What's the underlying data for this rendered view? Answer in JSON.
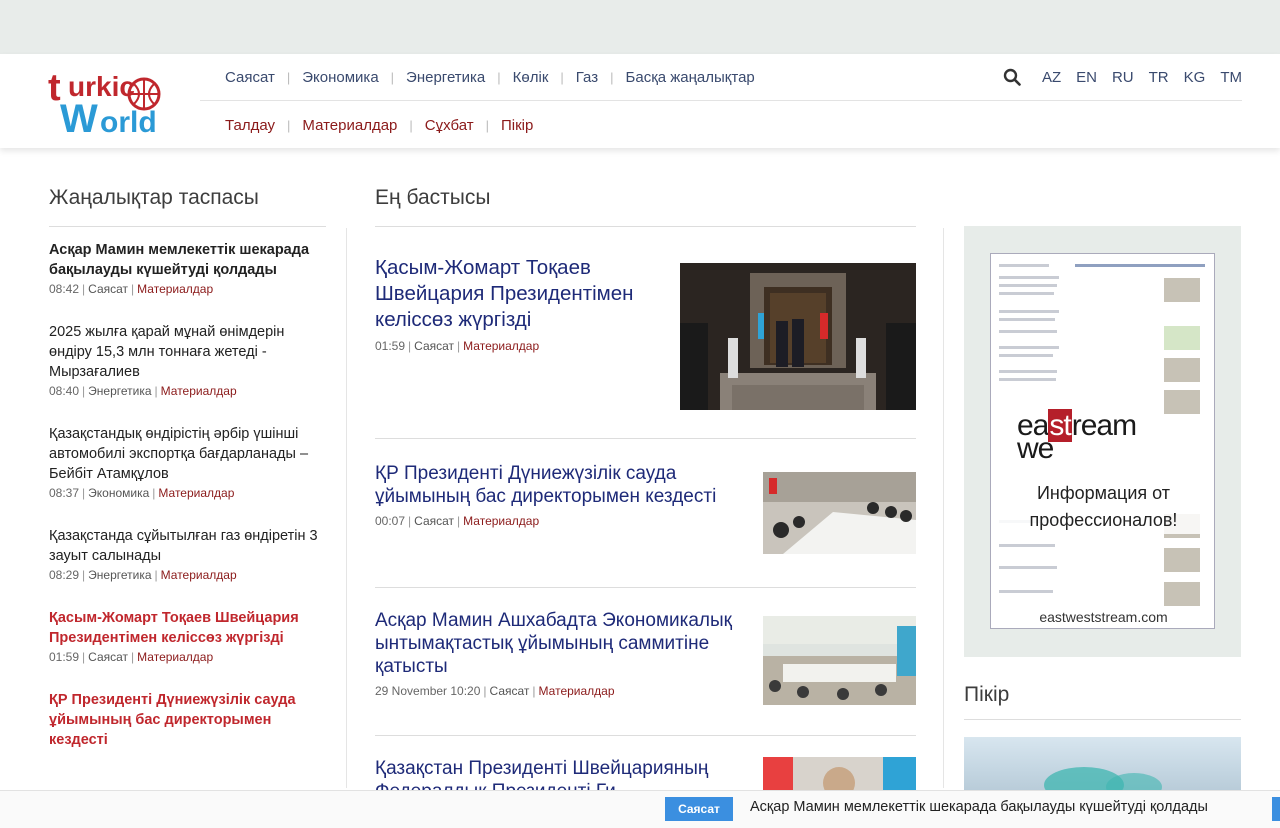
{
  "header": {
    "logo_alt": "Turkic World",
    "nav_primary": [
      "Саясат",
      "Экономика",
      "Энергетика",
      "Көлік",
      "Газ",
      "Басқа жаңалықтар"
    ],
    "nav_secondary": [
      "Талдау",
      "Материалдар",
      "Сұхбат",
      "Пікір"
    ],
    "languages": [
      "AZ",
      "EN",
      "RU",
      "TR",
      "KG",
      "TM"
    ]
  },
  "feed": {
    "title": "Жаңалықтар таспасы",
    "items": [
      {
        "title": "Асқар Мамин мемлекеттік шекарада бақылауды күшейтуді қолдады",
        "time": "08:42",
        "category": "Саясат",
        "type": "Материалдар"
      },
      {
        "title": "2025 жылға қарай мұнай өнімдерін өндіру 15,3 млн тоннаға жетеді - Мырзағалиев",
        "time": "08:40",
        "category": "Энергетика",
        "type": "Материалдар"
      },
      {
        "title": "Қазақстандық өндірістің әрбір үшінші автомобилі экспортқа бағдарланады – Бейбіт Атамқұлов",
        "time": "08:37",
        "category": "Экономика",
        "type": "Материалдар"
      },
      {
        "title": "Қазақстанда сұйытылған газ өндіретін 3 зауыт салынады",
        "time": "08:29",
        "category": "Энергетика",
        "type": "Материалдар"
      },
      {
        "title": "Қасым-Жомарт Тоқаев Швейцария Президентімен келіссөз жүргізді",
        "time": "01:59",
        "category": "Саясат",
        "type": "Материалдар"
      },
      {
        "title": "ҚР Президенті Дүниежүзілік сауда ұйымының бас директорымен кездесті",
        "time": "",
        "category": "",
        "type": ""
      }
    ]
  },
  "main": {
    "title": "Ең бастысы",
    "stories": [
      {
        "title": "Қасым-Жомарт Тоқаев Швейцария Президентімен келіссөз жүргізді",
        "time": "01:59",
        "category": "Саясат",
        "type": "Материалдар"
      },
      {
        "title": "ҚР Президенті Дүниежүзілік сауда ұйымының бас директорымен кездесті",
        "time": "00:07",
        "category": "Саясат",
        "type": "Материалдар"
      },
      {
        "title": "Асқар Мамин Ашхабадта Экономикалық ынтымақтастық ұйымының саммитіне қатысты",
        "time": "29 November 10:20",
        "category": "Саясат",
        "type": "Материалдар"
      },
      {
        "title": "Қазақстан Президенті Швейцарияның Федералдық Президенті Ги",
        "time": "",
        "category": "",
        "type": ""
      }
    ]
  },
  "ad": {
    "logo_top": "ea",
    "logo_mid": "st",
    "logo_rest": "ream",
    "logo_bottom": "we",
    "text": "Информация от профессионалов!",
    "url": "eastweststream.com"
  },
  "right": {
    "title": "Пікір"
  },
  "ticker": {
    "badge": "Саясат",
    "text": "Асқар Мамин мемлекеттік шекарада бақылауды күшейтуді қолдады"
  },
  "colors": {
    "accent": "#8b1a1a",
    "link": "#1e2a78",
    "nav": "#3a4a6e",
    "ticker_badge": "#3b8fe0"
  }
}
